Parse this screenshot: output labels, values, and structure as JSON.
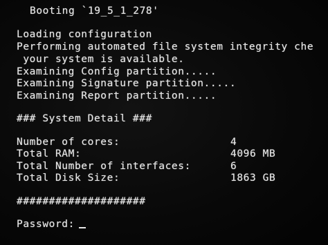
{
  "console": {
    "boot_line": "Booting `19_5_1_278'",
    "messages": [
      "Loading configuration",
      "Performing automated file system integrity che",
      " your system is available.",
      "Examining Config partition.....",
      "Examining Signature partition.....",
      "Examining Report partition....."
    ],
    "section_header": "### System Detail ###",
    "details": [
      {
        "label": "Number of cores:",
        "value": "4"
      },
      {
        "label": "Total RAM:",
        "value": "4096 MB"
      },
      {
        "label": "Total Number of interfaces:",
        "value": "6"
      },
      {
        "label": "Total Disk Size:",
        "value": "1863 GB"
      }
    ],
    "separator": "####################",
    "password_prompt": "Password:"
  },
  "colors": {
    "background": "#070707",
    "text": "#e8e8e8"
  }
}
